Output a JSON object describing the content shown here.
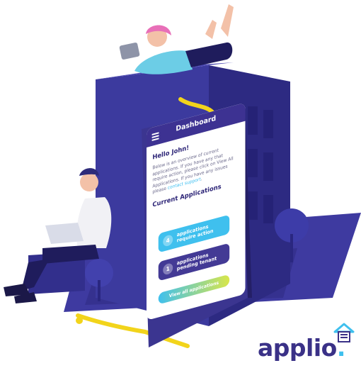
{
  "phone": {
    "header_title": "Dashboard",
    "greeting": "Hello John!",
    "intro_text": "Below is an overview of current applications. If you have any that require action, please click on View All Applications. If you have any issues please ",
    "contact_link": "contact support",
    "intro_end": ".",
    "section_title": "Current Applications",
    "cards": [
      {
        "count": "4",
        "label_line1": "applications",
        "label_line2": "require action",
        "color": "#3fc0ee"
      },
      {
        "count": "1",
        "label_line1": "applications",
        "label_line2": "pending tenant",
        "color": "#433a95"
      }
    ],
    "view_all_label": "View all applications"
  },
  "brand": {
    "name": "applio",
    "accent": "#3a3187",
    "dot_color": "#3fc0ee"
  },
  "icons": [
    "hamburger-menu-icon",
    "house-logo-icon"
  ]
}
